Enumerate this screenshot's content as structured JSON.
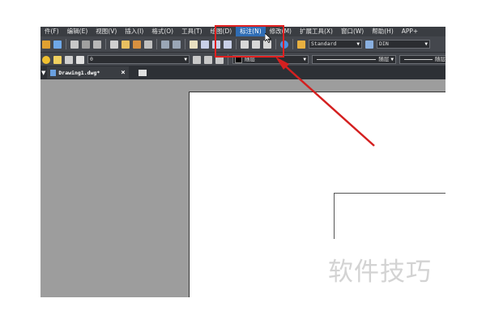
{
  "menubar": {
    "items": [
      "件(F)",
      "编辑(E)",
      "视图(V)",
      "插入(I)",
      "格式(O)",
      "工具(T)",
      "绘图(D)",
      "标注(N)",
      "修改(M)",
      "扩展工具(X)",
      "窗口(W)",
      "帮助(H)",
      "APP+"
    ],
    "active_index": 7
  },
  "toolbar1": {
    "text_style": "Standard",
    "dim_style": "DIN"
  },
  "toolbar2": {
    "layer_value": "0",
    "color_value": "随层",
    "linetype_value": "随层",
    "lineweight_value": "随层"
  },
  "tabs": [
    {
      "label": "Drawing1.dwg*"
    }
  ],
  "watermark": "软件技巧",
  "colors": {
    "menubar_bg": "#3a3d42",
    "active_menu": "#2f6db5",
    "workspace": "#9d9d9d",
    "annotation": "#e02020"
  }
}
